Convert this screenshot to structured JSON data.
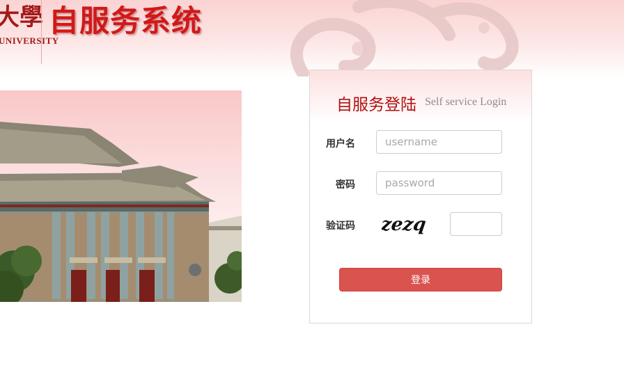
{
  "header": {
    "logo_char": "大學",
    "logo_subtitle": "UNIVERSITY",
    "system_title": "自服务系统"
  },
  "login": {
    "title": "自服务登陆",
    "subtitle": "Self service Login",
    "username_label": "用户名",
    "username_placeholder": "username",
    "password_label": "密码",
    "password_placeholder": "password",
    "captcha_label": "验证码",
    "captcha_text": "zezq",
    "captcha_placeholder": "",
    "submit_label": "登录"
  },
  "colors": {
    "brand_red": "#d11919",
    "button_red": "#d9534f",
    "header_pink": "#fbd3d3"
  }
}
